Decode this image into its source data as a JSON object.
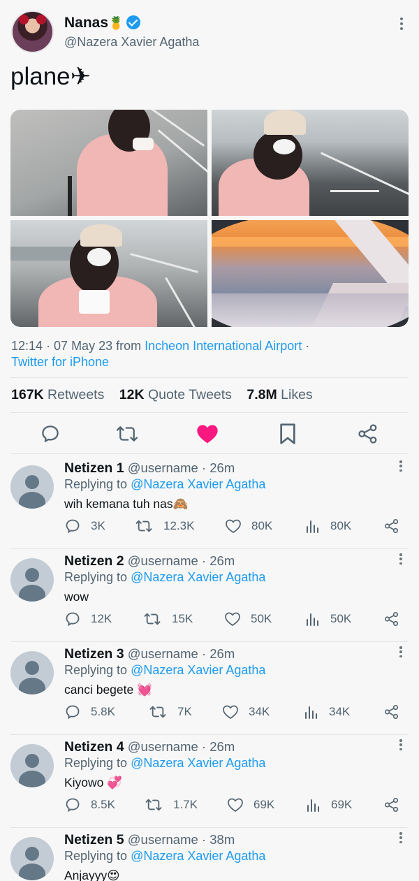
{
  "tweet": {
    "display_name": "Nanas",
    "name_emoji": "🍍",
    "handle": "@Nazera Xavier Agatha",
    "text": "plane✈",
    "time": "12:14 · 07 May 23 from ",
    "location": "Incheon International Airport",
    "separator": " ·",
    "client": "Twitter for iPhone",
    "stats": {
      "retweets_count": "167K",
      "retweets_label": "Retweets",
      "quotes_count": "12K",
      "quotes_label": "Quote Tweets",
      "likes_count": "7.8M",
      "likes_label": "Likes"
    },
    "icons": [
      "more-icon",
      "verified-badge-icon",
      "reply-icon",
      "retweet-icon",
      "like-icon",
      "bookmark-icon",
      "share-icon"
    ],
    "like_color": "#f91880",
    "accent_color": "#1d9bf0"
  },
  "replies": [
    {
      "name": "Netizen 1",
      "meta": "@username · 26m",
      "replying_label": "Replying to ",
      "replying_to": "@Nazera Xavier Agatha",
      "text": "wih kemana tuh nas🙈",
      "replies": "3K",
      "retweets": "12.3K",
      "likes": "80K",
      "views": "80K"
    },
    {
      "name": "Netizen 2",
      "meta": "@username · 26m",
      "replying_label": "Replying to ",
      "replying_to": "@Nazera Xavier Agatha",
      "text": "wow",
      "replies": "12K",
      "retweets": "15K",
      "likes": "50K",
      "views": "50K"
    },
    {
      "name": "Netizen 3",
      "meta": "@username · 26m",
      "replying_label": "Replying to ",
      "replying_to": "@Nazera Xavier Agatha",
      "text": "canci begete 💓",
      "replies": "5.8K",
      "retweets": "7K",
      "likes": "34K",
      "views": "34K"
    },
    {
      "name": "Netizen 4",
      "meta": "@username · 26m",
      "replying_label": "Replying to ",
      "replying_to": "@Nazera Xavier Agatha",
      "text": "Kiyowo 💞",
      "replies": "8.5K",
      "retweets": "1.7K",
      "likes": "69K",
      "views": "69K"
    },
    {
      "name": "Netizen 5",
      "meta": "@username · 38m",
      "replying_label": "Replying to ",
      "replying_to": "@Nazera Xavier Agatha",
      "text": "Anjayyy😍",
      "replies": "",
      "retweets": "",
      "likes": "",
      "views": ""
    }
  ]
}
